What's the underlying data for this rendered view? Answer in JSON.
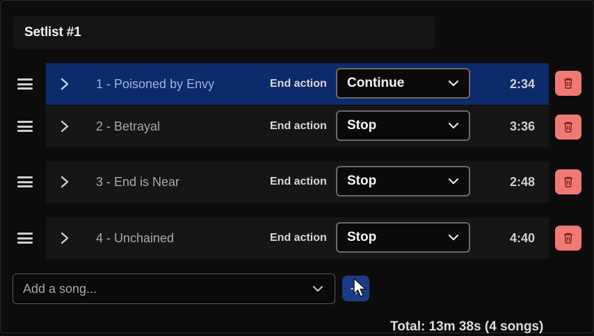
{
  "setlist": {
    "title": "Setlist #1"
  },
  "end_action_label": "End action",
  "songs": [
    {
      "label": "1 - Poisoned by Envy",
      "end_action": "Continue",
      "duration": "2:34",
      "active": true
    },
    {
      "label": "2 - Betrayal",
      "end_action": "Stop",
      "duration": "3:36",
      "active": false
    },
    {
      "label": "3 - End is Near",
      "end_action": "Stop",
      "duration": "2:48",
      "active": false
    },
    {
      "label": "4 - Unchained",
      "end_action": "Stop",
      "duration": "4:40",
      "active": false
    }
  ],
  "add_song": {
    "placeholder": "Add a song..."
  },
  "summary": {
    "total": "Total: 13m 38s (4 songs)"
  },
  "colors": {
    "active_row": "#0d2a6b",
    "delete": "#f07a73",
    "add_button": "#1c3a86"
  },
  "icons": {
    "drag": "drag-handle-icon",
    "expand": "chevron-right-icon",
    "delete": "trash-icon",
    "add": "plus-icon",
    "dropdown": "chevron-down-icon"
  }
}
